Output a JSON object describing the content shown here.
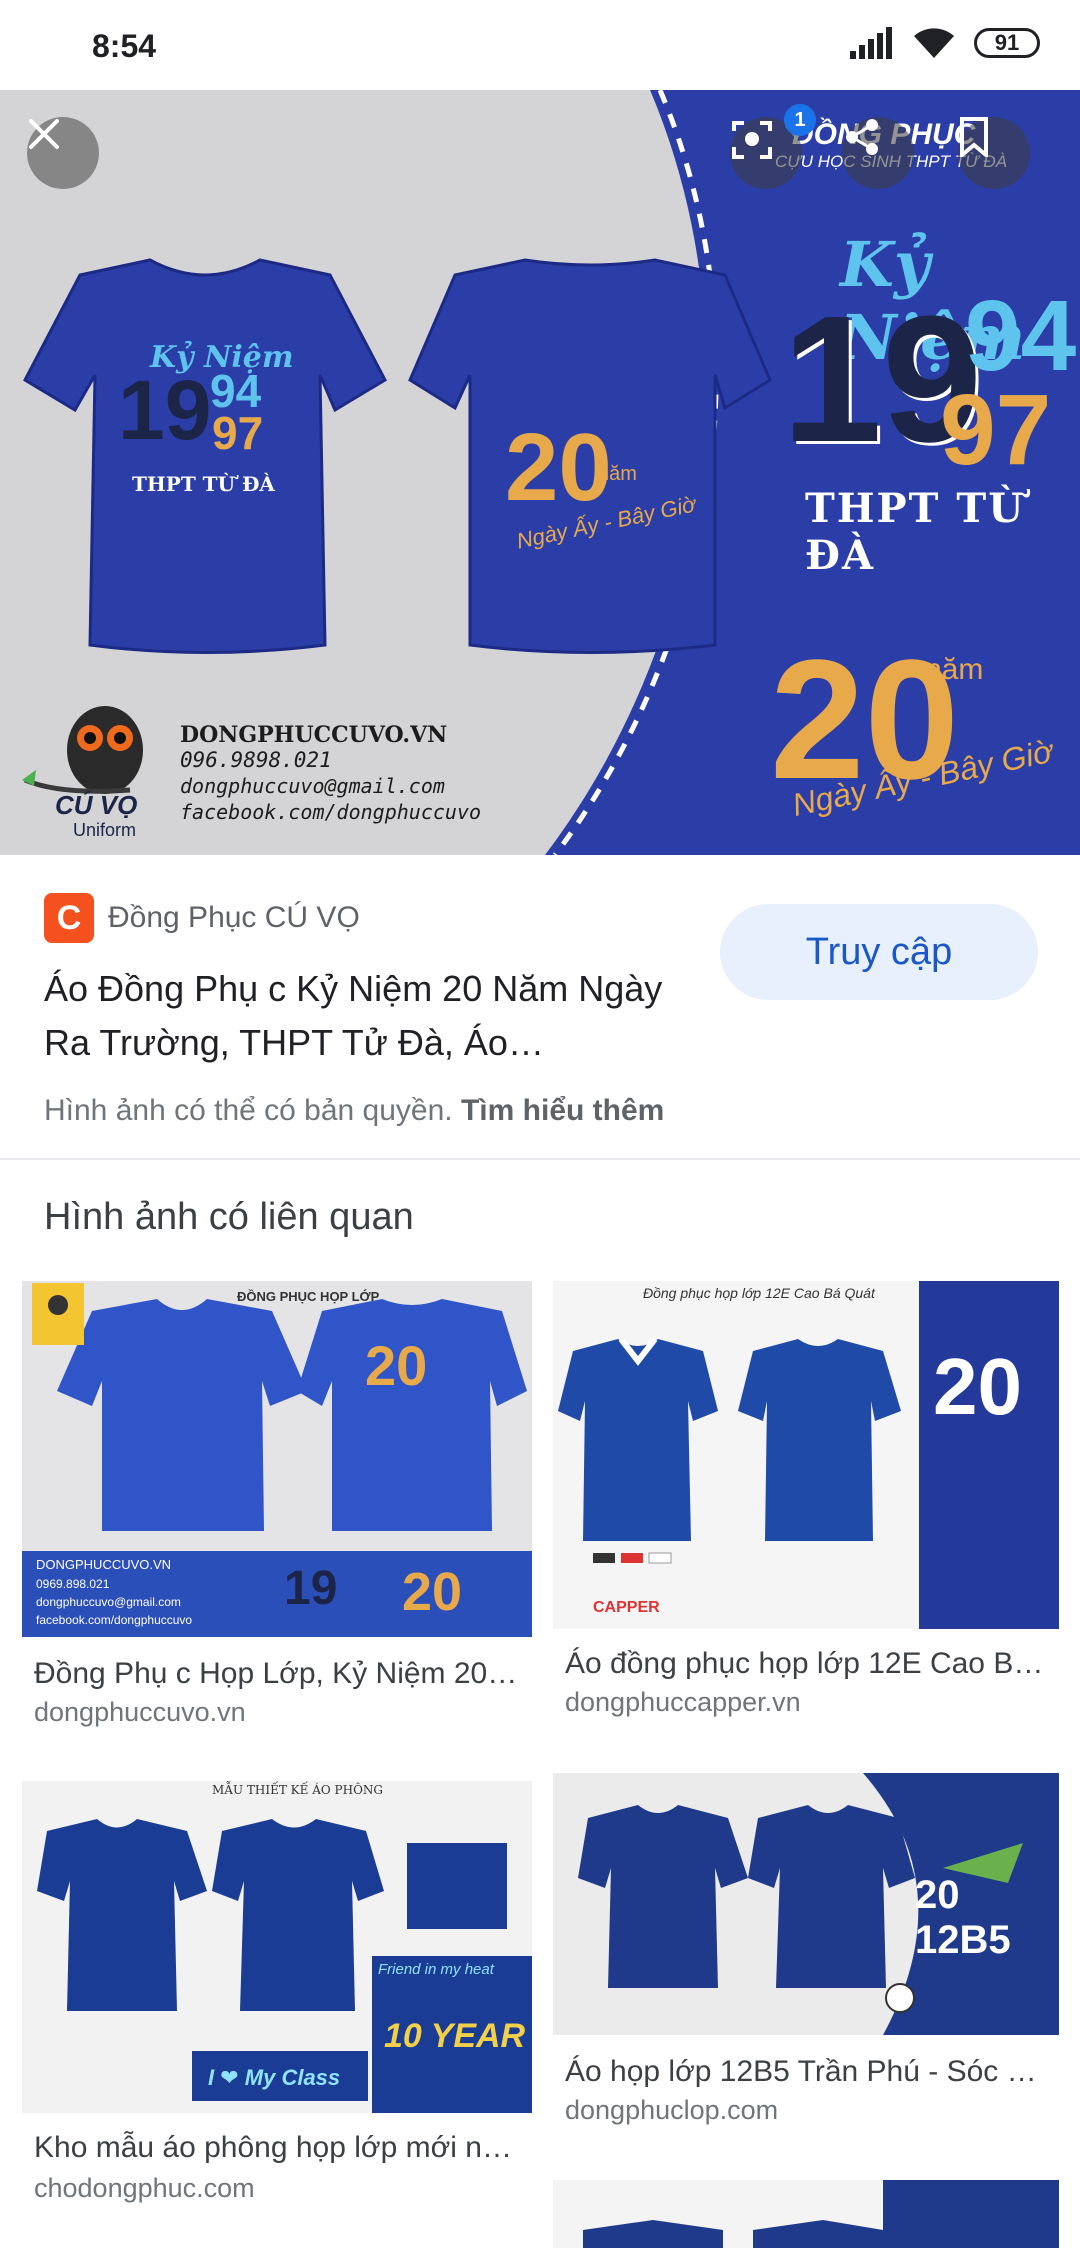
{
  "status_bar": {
    "time": "8:54",
    "battery": "91"
  },
  "hero": {
    "brand_line": "ĐỒNG PHỤC",
    "brand_sub": "CỰU HỌC SINH THPT TỪ ĐÀ",
    "year_top": "19",
    "year_94": "94",
    "year_97": "97",
    "kyniem": "Kỷ Niệm",
    "school": "THPT TỪ ĐÀ",
    "twenty": "20",
    "nam": "năm",
    "slogan": "Ngày Ấy - Bây Giờ",
    "contact_site": "DONGPHUCCUVO.VN",
    "contact_phone": "096.9898.021",
    "contact_email": "dongphuccuvo@gmail.com",
    "contact_fb": "facebook.com/dongphuccuvo",
    "logo_text": "CÚ VỌ",
    "logo_sub": "Uniform",
    "badge_count": "1",
    "colors": {
      "navy": "#2b3ea8",
      "orange": "#e8a94a",
      "cyan": "#5ec4ee",
      "dark": "#1c2547"
    }
  },
  "source": {
    "logo_letter": "C",
    "name": "Đồng Phục CÚ VỌ",
    "title": "Áo Đồng Phụ c Kỷ Niệm 20 Năm Ngày Ra Trường, THPT Tử Đà, Áo…",
    "visit_label": "Truy cập",
    "copyright_text": "Hình ảnh có thể có bản quyền.",
    "learn_more": "Tìm hiểu thêm"
  },
  "related": {
    "heading": "Hình ảnh có liên quan",
    "items": [
      {
        "caption": "Đồng Phụ c Họp Lớp, Kỷ Niệm 20…",
        "domain": "dongphuccuvo.vn",
        "thumb_header": "ĐỒNG PHỤC HỌP LỚP",
        "thumb_site": "DONGPHUCCUVO.VN",
        "thumb_phone": "0969.898.021",
        "thumb_mail": "dongphuccuvo@gmail.com",
        "thumb_fb": "facebook.com/dongphuccuvo"
      },
      {
        "caption": "Áo đồng phục họp lớp 12E Cao B…",
        "domain": "dongphuccapper.vn",
        "thumb_header": "Đồng phục họp lớp 12E Cao Bá Quát",
        "thumb_brand": "CAPPER"
      },
      {
        "caption": "Kho mẫu áo phông họp lớp mới n…",
        "domain": "chodongphuc.com",
        "thumb_header": "MẪU THIẾT KẾ ÁO PHÔNG",
        "thumb_heart": "I ❤ My Class",
        "thumb_friend": "Friend in my heat",
        "thumb_ten": "10 YEAR"
      },
      {
        "caption": "Áo họp lớp 12B5 Trần Phú - Sóc …",
        "domain": "dongphuclop.com",
        "thumb_label": "20 12B5"
      },
      {
        "caption": "",
        "domain": ""
      }
    ]
  }
}
